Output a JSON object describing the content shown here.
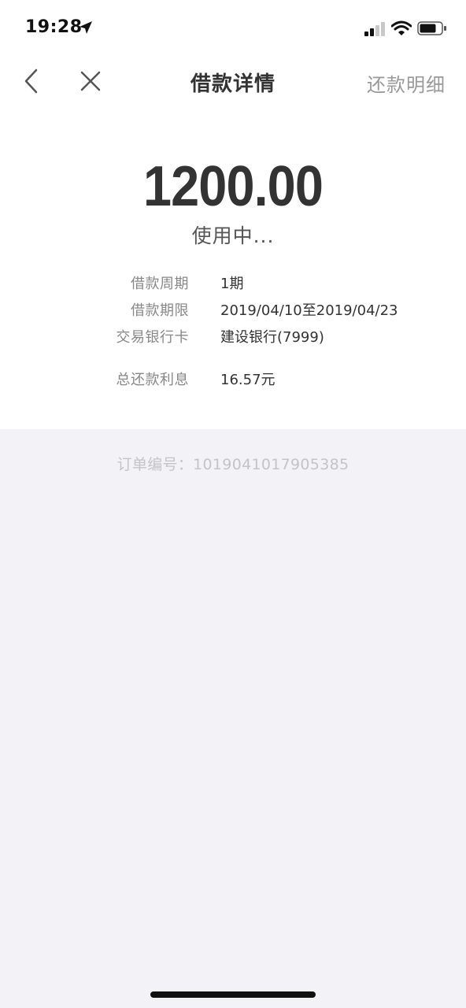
{
  "status_bar": {
    "time": "19:28"
  },
  "nav": {
    "title": "借款详情",
    "right_action": "还款明细",
    "icons": {
      "back": "chevron-left-icon",
      "close": "close-icon"
    }
  },
  "loan": {
    "amount": "1200.00",
    "status": "使用中...",
    "details": [
      {
        "label": "借款周期",
        "value": "1期"
      },
      {
        "label": "借款期限",
        "value": "2019/04/10至2019/04/23"
      },
      {
        "label": "交易银行卡",
        "value": "建设银行(7999)"
      },
      {
        "label": "总还款利息",
        "value": "16.57元"
      }
    ]
  },
  "order": {
    "text": "订单编号：1019041017905385"
  },
  "colors": {
    "page_background": "#f3f3f7",
    "card_background": "#ffffff",
    "primary_text": "#333333",
    "secondary_text": "#888888",
    "muted_text": "#c4c4c8"
  }
}
